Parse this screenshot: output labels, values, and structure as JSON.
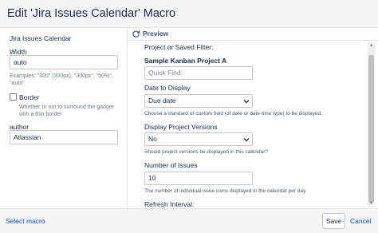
{
  "dialog": {
    "title": "Edit 'Jira Issues Calendar' Macro"
  },
  "sidebar": {
    "macro_name": "Jira Issues Calendar",
    "width_label": "Width",
    "width_value": "auto",
    "width_help_line1": "Examples: \"300\" (300px), \"300px\", \"50%\",",
    "width_help_line2": "\"auto\"",
    "border_label": "Border",
    "border_help_line1": "Whether or not to surround the gadget",
    "border_help_line2": "with a thin border",
    "author_label": "author",
    "author_value": "Atlassian"
  },
  "preview": {
    "label": "Preview",
    "fields": {
      "project_label": "Project or Saved Filter:",
      "project_name": "Sample Kanban Project A",
      "quick_find_placeholder": "Quick Find:",
      "date_label": "Date to Display",
      "date_value": "Due date",
      "date_help": "Choose a standard or custom field (of date or date-time type) to be displayed.",
      "versions_label": "Display Project Versions",
      "versions_value": "No",
      "versions_help": "Should project versions be displayed in this calendar?",
      "issues_label": "Number of Issues",
      "issues_value": "10",
      "issues_help": "The number of individual issue icons displayed in the calendar per day.",
      "refresh_label": "Refresh Interval:"
    }
  },
  "footer": {
    "select_macro": "Select macro",
    "save": "Save",
    "cancel": "Cancel"
  },
  "colors": {
    "link": "#0052cc",
    "header_bg": "#f4f5f7",
    "border": "#dfe1e6"
  },
  "icons": [
    "refresh-icon",
    "chevron-down-icon",
    "checkbox"
  ]
}
